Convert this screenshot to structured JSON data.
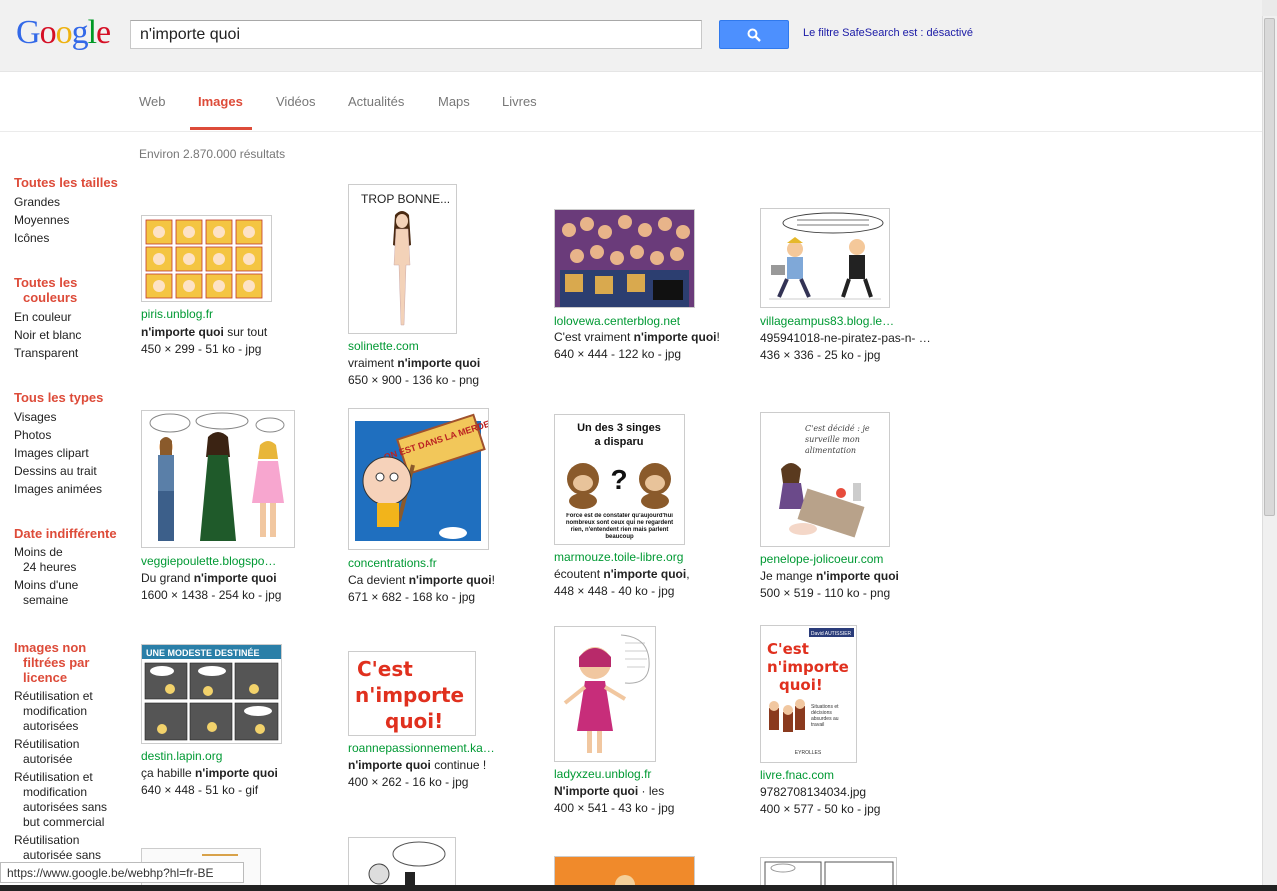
{
  "logo": {
    "letters": [
      "G",
      "o",
      "o",
      "g",
      "l",
      "e"
    ],
    "colors": [
      "#3369e8",
      "#d50f25",
      "#eeb211",
      "#3369e8",
      "#009925",
      "#d50f25"
    ]
  },
  "search": {
    "value": "n'importe quoi"
  },
  "safesearch": "Le filtre SafeSearch est : désactivé",
  "tabs": [
    "Web",
    "Images",
    "Vidéos",
    "Actualités",
    "Maps",
    "Livres"
  ],
  "result_count": "Environ 2.870.000 résultats",
  "sidebar": {
    "sizes": {
      "head": "Toutes les tailles",
      "items": [
        "Grandes",
        "Moyennes",
        "Icônes"
      ]
    },
    "colors": {
      "head1": "Toutes les",
      "head2": "couleurs",
      "items": [
        "En couleur",
        "Noir et blanc",
        "Transparent"
      ]
    },
    "types": {
      "head": "Tous les types",
      "items": [
        "Visages",
        "Photos",
        "Images clipart",
        "Dessins au trait",
        "Images animées"
      ]
    },
    "date": {
      "head": "Date indifférente",
      "items": [
        [
          "Moins de",
          "24 heures"
        ],
        [
          "Moins d'une",
          "semaine"
        ]
      ]
    },
    "license": {
      "head1": "Images non",
      "head2": "filtrées par",
      "head3": "licence",
      "items": [
        [
          "Réutilisation et",
          "modification",
          "autorisées"
        ],
        [
          "Réutilisation",
          "autorisée"
        ],
        [
          "Réutilisation et",
          "modification",
          "autorisées sans",
          "but commercial"
        ],
        [
          "Réutilisation",
          "autorisée sans"
        ]
      ]
    }
  },
  "results": [
    {
      "domain": "piris.unblog.fr",
      "pre": "",
      "bold": "n'importe quoi",
      "post": " sur tout",
      "meta": "450 × 299 - 51 ko - jpg"
    },
    {
      "domain": "solinette.com",
      "pre": "vraiment ",
      "bold": "n'importe quoi",
      "post": "",
      "meta": "650 × 900 - 136 ko - png"
    },
    {
      "domain": "lolovewa.centerblog.net",
      "pre": "C'est vraiment ",
      "bold": "n'importe quoi",
      "post": "!",
      "meta": "640 × 444 - 122 ko - jpg"
    },
    {
      "domain": "villageampus83.blog.le…",
      "pre": "495941018-ne-piratez-pas-n- …",
      "bold": "",
      "post": "",
      "meta": "436 × 336 - 25 ko - jpg"
    },
    {
      "domain": "veggiepoulette.blogspo…",
      "pre": "Du grand ",
      "bold": "n'importe quoi",
      "post": "",
      "meta": "1600 × 1438 - 254 ko - jpg"
    },
    {
      "domain": "concentrations.fr",
      "pre": "Ca devient ",
      "bold": "n'importe quoi",
      "post": "!",
      "meta": "671 × 682 - 168 ko - jpg"
    },
    {
      "domain": "marmouze.toile-libre.org",
      "pre": "écoutent ",
      "bold": "n'importe quoi",
      "post": ",",
      "meta": "448 × 448 - 40 ko - jpg"
    },
    {
      "domain": "penelope-jolicoeur.com",
      "pre": "Je mange ",
      "bold": "n'importe quoi",
      "post": "",
      "meta": "500 × 519 - 110 ko - png"
    },
    {
      "domain": "destin.lapin.org",
      "pre": "ça habille ",
      "bold": "n'importe quoi",
      "post": "",
      "meta": "640 × 448 - 51 ko - gif"
    },
    {
      "domain": "roannepassionnement.ka…",
      "pre": "",
      "bold": "n'importe quoi",
      "post": " continue !",
      "meta": "400 × 262 - 16 ko - jpg"
    },
    {
      "domain": "ladyxzeu.unblog.fr",
      "pre": "",
      "bold": "N'importe quoi",
      "post": " · les",
      "meta": "400 × 541 - 43 ko - jpg"
    },
    {
      "domain": "livre.fnac.com",
      "pre": "9782708134034.jpg",
      "bold": "",
      "post": "",
      "meta": "400 × 577 - 50 ko - jpg"
    }
  ],
  "thumb_text": {
    "trop_bonne": "TROP BONNE...",
    "on_est": "ON EST DANS LA MERDE !",
    "singes_title1": "Un des 3 singes",
    "singes_title2": "a disparu",
    "singes_q": "?",
    "singes_caption": "Force est de constater qu'aujourd'hui nombreux sont ceux qui ne regardent rien, n'entendent rien mais parlent beaucoup",
    "penelope": "C'est décidé : je surveille mon alimentation",
    "modeste": "UNE MODESTE DESTINÉE",
    "cest_line1": "C'est",
    "cest_line2": "n'importe",
    "cest_line3": "quoi!",
    "fnac_author": "David AUTISSIER",
    "fnac_sub": "Situations et décisions absurdes au travail",
    "fnac_pub": "EYROLLES"
  },
  "status_url": "https://www.google.be/webhp?hl=fr-BE"
}
